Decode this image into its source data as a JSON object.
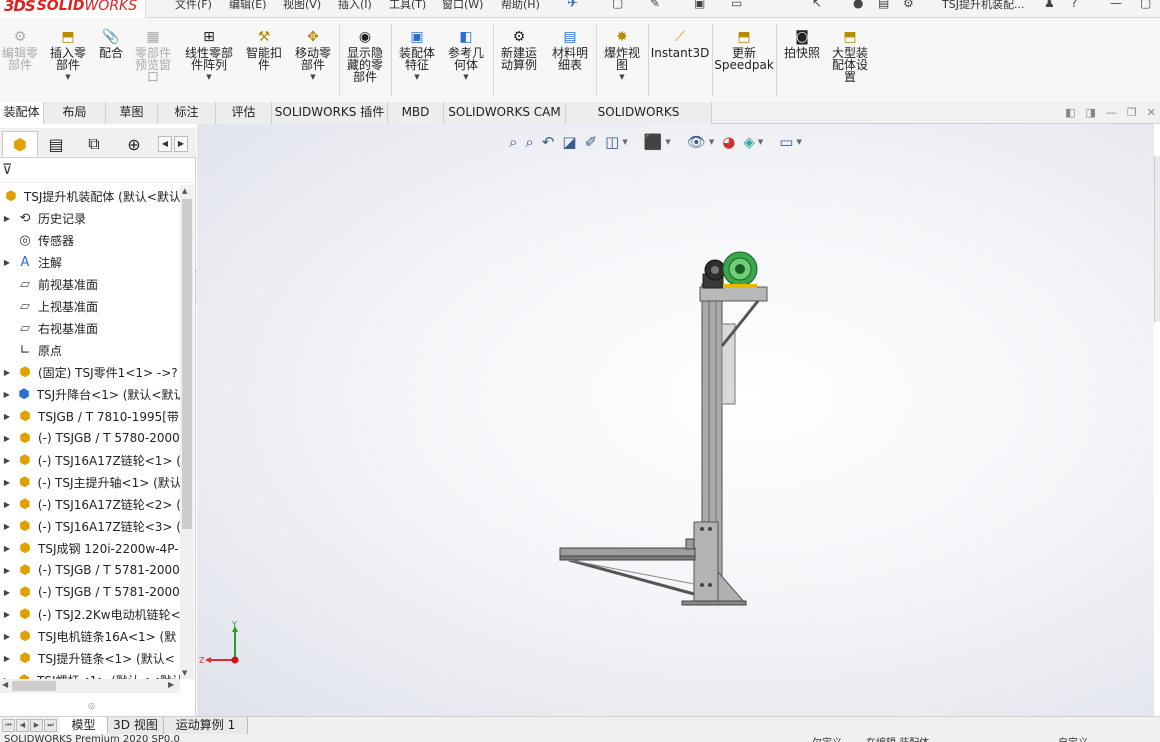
{
  "app": {
    "logo_prefix": "3DS",
    "logo_main": "SOLID",
    "logo_suffix": "WORKS",
    "document_title": "TSJ提升机装配..."
  },
  "menu": {
    "items": [
      "文件(F)",
      "编辑(E)",
      "视图(V)",
      "插入(I)",
      "工具(T)",
      "窗口(W)",
      "帮助(H)"
    ]
  },
  "command_manager": {
    "buttons": [
      {
        "label": "编辑零\n部件",
        "icon": "edit-component-icon",
        "enabled": false
      },
      {
        "label": "插入零\n部件",
        "icon": "insert-component-icon",
        "enabled": true
      },
      {
        "label": "配合",
        "icon": "mate-icon",
        "enabled": true
      },
      {
        "label": "零部件\n预览窗\n口",
        "icon": "component-preview-icon",
        "enabled": false
      },
      {
        "label": "线性零部\n件阵列",
        "icon": "linear-pattern-icon",
        "enabled": true
      },
      {
        "label": "智能扣\n件",
        "icon": "smart-fasteners-icon",
        "enabled": true
      },
      {
        "label": "移动零\n部件",
        "icon": "move-component-icon",
        "enabled": true
      },
      {
        "label": "显示隐\n藏的零\n部件",
        "icon": "show-hidden-icon",
        "enabled": true
      },
      {
        "label": "装配体\n特征",
        "icon": "assembly-features-icon",
        "enabled": true
      },
      {
        "label": "参考几\n何体",
        "icon": "reference-geometry-icon",
        "enabled": true
      },
      {
        "label": "新建运\n动算例",
        "icon": "new-motion-study-icon",
        "enabled": true
      },
      {
        "label": "材料明\n细表",
        "icon": "bill-of-materials-icon",
        "enabled": true
      },
      {
        "label": "爆炸视\n图",
        "icon": "exploded-view-icon",
        "enabled": true
      },
      {
        "label": "Instant3D",
        "icon": "instant3d-icon",
        "enabled": true
      },
      {
        "label": "更新\nSpeedpak",
        "icon": "speedpak-icon",
        "enabled": true
      },
      {
        "label": "拍快照",
        "icon": "snapshot-icon",
        "enabled": true
      },
      {
        "label": "大型装\n配体设\n置",
        "icon": "large-assembly-icon",
        "enabled": true
      }
    ]
  },
  "command_tabs": [
    "装配体",
    "布局",
    "草图",
    "标注",
    "评估",
    "SOLIDWORKS 插件",
    "MBD",
    "SOLIDWORKS CAM",
    "SOLIDWORKS Inspection"
  ],
  "active_command_tab": "装配体",
  "feature_tree": {
    "root": "TSJ提升机装配体  (默认<默认",
    "nodes": [
      {
        "label": "历史记录",
        "icon": "history-icon",
        "expandable": true
      },
      {
        "label": "传感器",
        "icon": "sensor-icon",
        "expandable": false
      },
      {
        "label": "注解",
        "icon": "annotations-icon",
        "expandable": true
      },
      {
        "label": "前视基准面",
        "icon": "plane-icon",
        "expandable": false
      },
      {
        "label": "上视基准面",
        "icon": "plane-icon",
        "expandable": false
      },
      {
        "label": "右视基准面",
        "icon": "plane-icon",
        "expandable": false
      },
      {
        "label": "原点",
        "icon": "origin-icon",
        "expandable": false
      },
      {
        "label": "(固定) TSJ零件1<1> ->?",
        "icon": "part-icon",
        "expandable": true
      },
      {
        "label": "TSJ升降台<1> (默认<默认",
        "icon": "subassembly-icon",
        "expandable": true
      },
      {
        "label": "TSJGB / T 7810-1995[带",
        "icon": "part-icon",
        "expandable": true
      },
      {
        "label": "(-) TSJGB / T 5780-2000",
        "icon": "part-icon",
        "expandable": true
      },
      {
        "label": "(-) TSJ16A17Z链轮<1> (",
        "icon": "part-icon",
        "expandable": true
      },
      {
        "label": "(-) TSJ主提升轴<1> (默认",
        "icon": "part-icon",
        "expandable": true
      },
      {
        "label": "(-) TSJ16A17Z链轮<2> (",
        "icon": "part-icon",
        "expandable": true
      },
      {
        "label": "(-) TSJ16A17Z链轮<3> (",
        "icon": "part-icon",
        "expandable": true
      },
      {
        "label": "TSJ成钢 120i-2200w-4P-",
        "icon": "part-icon",
        "expandable": true
      },
      {
        "label": "(-) TSJGB / T 5781-2000",
        "icon": "part-icon",
        "expandable": true
      },
      {
        "label": "(-) TSJGB / T 5781-2000",
        "icon": "part-icon",
        "expandable": true
      },
      {
        "label": "(-) TSJ2.2Kw电动机链轮<",
        "icon": "part-icon",
        "expandable": true
      },
      {
        "label": "TSJ电机链条16A<1> (默",
        "icon": "part-icon",
        "expandable": true
      },
      {
        "label": "TSJ提升链条<1> (默认<",
        "icon": "part-icon",
        "expandable": true
      },
      {
        "label": "TSJ螺杆<1> (默认<<默认",
        "icon": "part-icon",
        "expandable": true
      }
    ]
  },
  "triad": {
    "y_label": "Y",
    "z_label": "Z"
  },
  "bottom_tabs": [
    "模型",
    "3D 视图",
    "运动算例 1"
  ],
  "active_bottom_tab": "模型",
  "status": {
    "left": "SOLIDWORKS Premium 2020 SP0.0",
    "middle_1": "欠定义",
    "middle_2": "在编辑 装配体",
    "right": "自定义"
  },
  "colors": {
    "accent_blue": "#2a6fd1",
    "logo_red": "#d22222",
    "part_yellow": "#e8b800",
    "frame_gray": "#9a9a9a",
    "motor_green": "#3aa64a"
  }
}
